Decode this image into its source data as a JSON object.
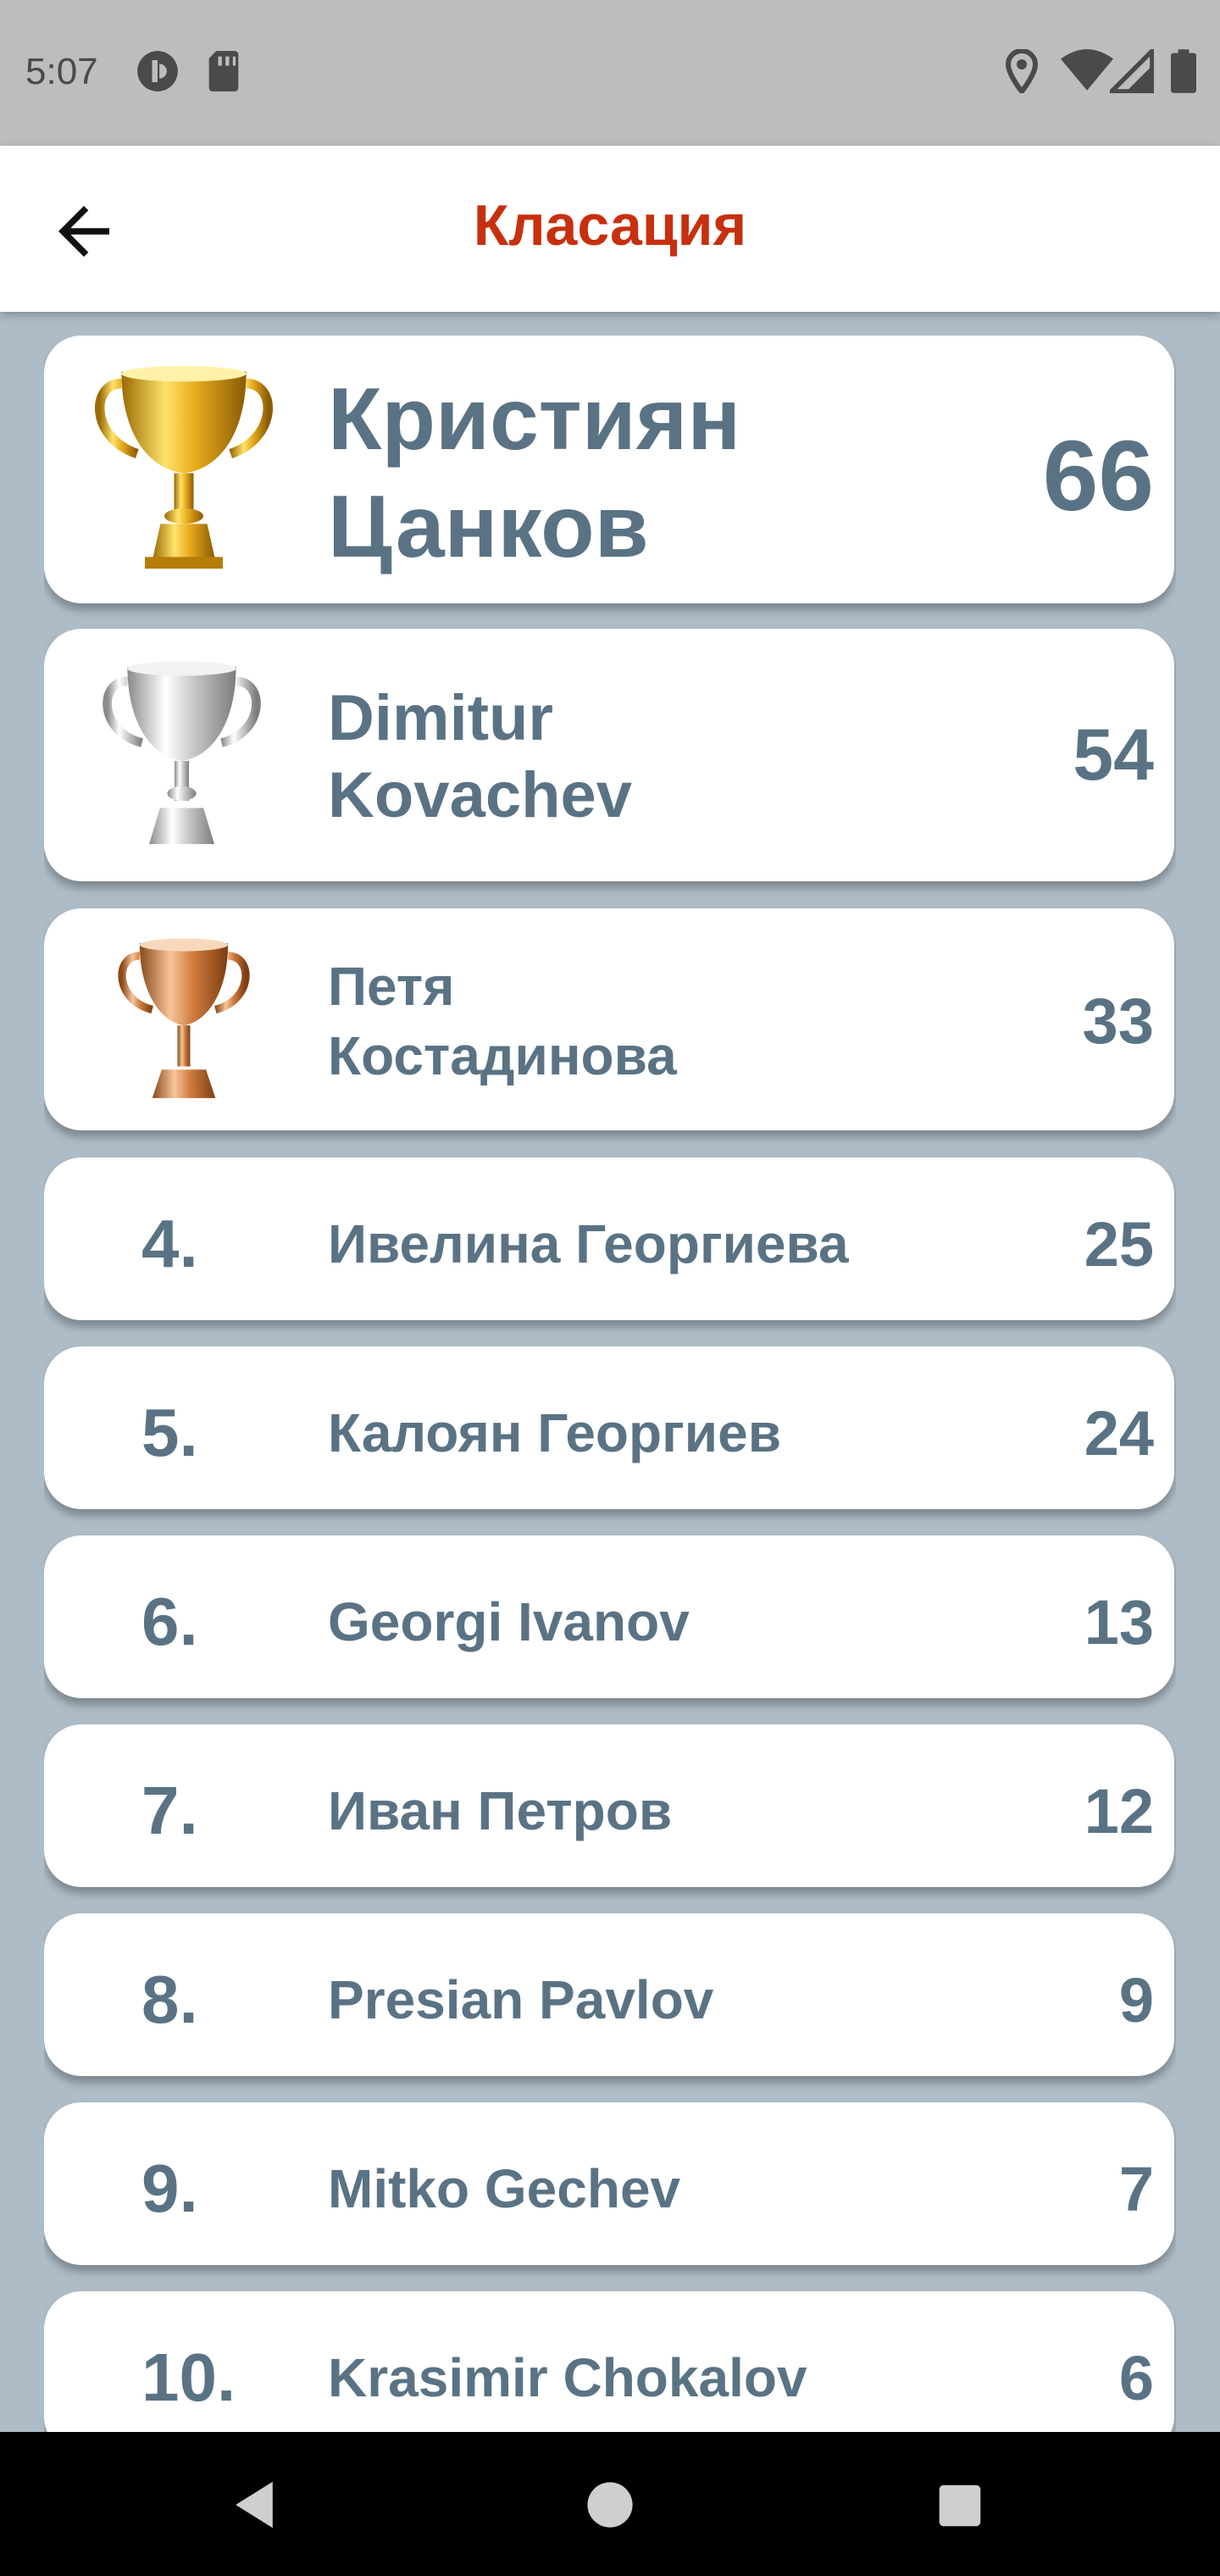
{
  "status_bar": {
    "time": "5:07",
    "icons": [
      "privacy-icon",
      "sd-card-icon",
      "location-icon",
      "wifi-icon",
      "signal-icon",
      "battery-icon"
    ]
  },
  "app_bar": {
    "title": "Класация",
    "back_icon": "arrow-back-icon"
  },
  "colors": {
    "title": "#c7300f",
    "text": "#5a7384",
    "background": "#adbcc7"
  },
  "podium": [
    {
      "name": "Кристиян\nЦанков",
      "score": "66",
      "trophy": "gold-trophy-icon"
    },
    {
      "name": "Dimitur\nKovachev",
      "score": "54",
      "trophy": "silver-trophy-icon"
    },
    {
      "name": "Петя\nКостадинова",
      "score": "33",
      "trophy": "bronze-trophy-icon"
    }
  ],
  "rankings": [
    {
      "rank": "4.",
      "name": "Ивелина Георгиева",
      "score": "25"
    },
    {
      "rank": "5.",
      "name": "Калоян Георгиев",
      "score": "24"
    },
    {
      "rank": "6.",
      "name": "Georgi Ivanov",
      "score": "13"
    },
    {
      "rank": "7.",
      "name": "Иван Петров",
      "score": "12"
    },
    {
      "rank": "8.",
      "name": "Presian Pavlov",
      "score": "9"
    },
    {
      "rank": "9.",
      "name": "Mitko Gechev",
      "score": "7"
    },
    {
      "rank": "10.",
      "name": "Krasimir Chokalov",
      "score": "6"
    }
  ],
  "nav_bar": {
    "icons": [
      "back-nav-icon",
      "home-nav-icon",
      "recents-nav-icon"
    ]
  }
}
